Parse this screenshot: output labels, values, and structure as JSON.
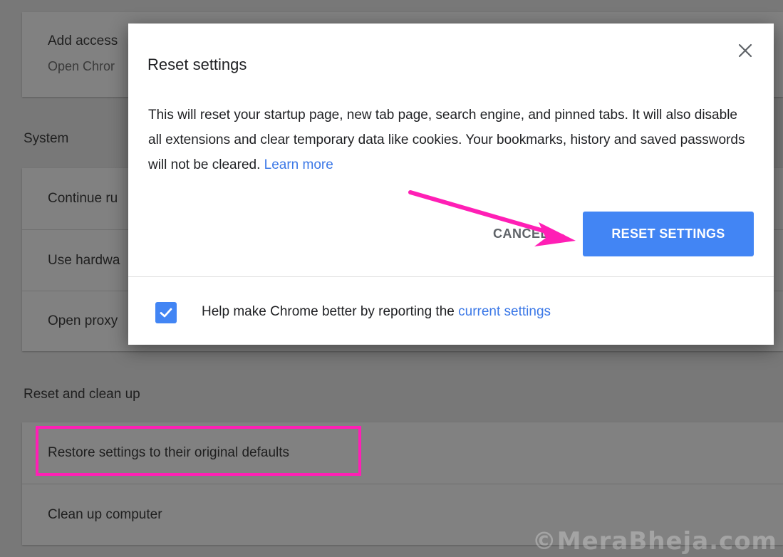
{
  "background": {
    "card1": {
      "title": "Add access",
      "subtitle": "Open Chror"
    },
    "system": {
      "title": "System",
      "rows": [
        "Continue ru",
        "Use hardwa",
        "Open proxy"
      ]
    },
    "reset_section": {
      "title": "Reset and clean up",
      "rows": [
        "Restore settings to their original defaults",
        "Clean up computer"
      ]
    }
  },
  "dialog": {
    "title": "Reset settings",
    "body": "This will reset your startup page, new tab page, search engine, and pinned tabs. It will also disable all extensions and clear temporary data like cookies. Your bookmarks, history and saved passwords will not be cleared.",
    "learn_more": "Learn more",
    "cancel_label": "CANCEL",
    "reset_label": "RESET SETTINGS",
    "footer_text": "Help make Chrome better by reporting the",
    "footer_link": "current settings",
    "checkbox_checked": true
  },
  "watermark": "©MeraBheja.com",
  "colors": {
    "accent": "#4285f4",
    "link": "#3b78e7",
    "annotation": "#ff1fb5"
  }
}
